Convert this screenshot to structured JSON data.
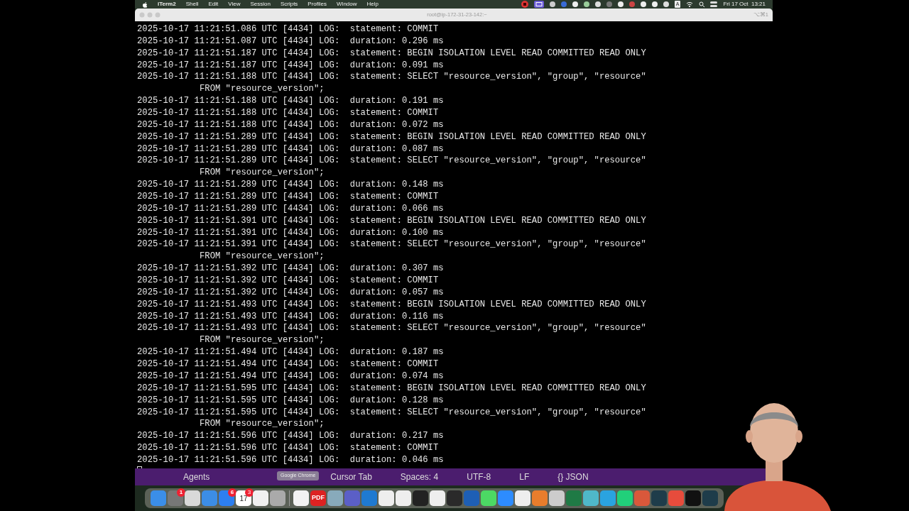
{
  "menu_bar": {
    "app": "iTerm2",
    "menus": [
      "Shell",
      "Edit",
      "View",
      "Session",
      "Scripts",
      "Profiles",
      "Window",
      "Help"
    ],
    "input_source": "A",
    "clock": "Fri 17 Oct  13:21"
  },
  "window": {
    "title": "root@ip-172-31-23-142:~",
    "shortcut": "⌥⌘1"
  },
  "terminal": {
    "lines": [
      {
        "kind": "log",
        "text": "2025-10-17 11:21:51.086 UTC [4434] LOG:  statement: COMMIT"
      },
      {
        "kind": "log",
        "text": "2025-10-17 11:21:51.087 UTC [4434] LOG:  duration: 0.296 ms"
      },
      {
        "kind": "log",
        "text": "2025-10-17 11:21:51.187 UTC [4434] LOG:  statement: BEGIN ISOLATION LEVEL READ COMMITTED READ ONLY"
      },
      {
        "kind": "log",
        "text": "2025-10-17 11:21:51.187 UTC [4434] LOG:  duration: 0.091 ms"
      },
      {
        "kind": "log",
        "text": "2025-10-17 11:21:51.188 UTC [4434] LOG:  statement: SELECT \"resource_version\", \"group\", \"resource\""
      },
      {
        "kind": "continuation",
        "text": "FROM \"resource_version\";"
      },
      {
        "kind": "log",
        "text": "2025-10-17 11:21:51.188 UTC [4434] LOG:  duration: 0.191 ms"
      },
      {
        "kind": "log",
        "text": "2025-10-17 11:21:51.188 UTC [4434] LOG:  statement: COMMIT"
      },
      {
        "kind": "log",
        "text": "2025-10-17 11:21:51.188 UTC [4434] LOG:  duration: 0.072 ms"
      },
      {
        "kind": "log",
        "text": "2025-10-17 11:21:51.289 UTC [4434] LOG:  statement: BEGIN ISOLATION LEVEL READ COMMITTED READ ONLY"
      },
      {
        "kind": "log",
        "text": "2025-10-17 11:21:51.289 UTC [4434] LOG:  duration: 0.087 ms"
      },
      {
        "kind": "log",
        "text": "2025-10-17 11:21:51.289 UTC [4434] LOG:  statement: SELECT \"resource_version\", \"group\", \"resource\""
      },
      {
        "kind": "continuation",
        "text": "FROM \"resource_version\";"
      },
      {
        "kind": "log",
        "text": "2025-10-17 11:21:51.289 UTC [4434] LOG:  duration: 0.148 ms"
      },
      {
        "kind": "log",
        "text": "2025-10-17 11:21:51.289 UTC [4434] LOG:  statement: COMMIT"
      },
      {
        "kind": "log",
        "text": "2025-10-17 11:21:51.289 UTC [4434] LOG:  duration: 0.066 ms"
      },
      {
        "kind": "log",
        "text": "2025-10-17 11:21:51.391 UTC [4434] LOG:  statement: BEGIN ISOLATION LEVEL READ COMMITTED READ ONLY"
      },
      {
        "kind": "log",
        "text": "2025-10-17 11:21:51.391 UTC [4434] LOG:  duration: 0.100 ms"
      },
      {
        "kind": "log",
        "text": "2025-10-17 11:21:51.391 UTC [4434] LOG:  statement: SELECT \"resource_version\", \"group\", \"resource\""
      },
      {
        "kind": "continuation",
        "text": "FROM \"resource_version\";"
      },
      {
        "kind": "log",
        "text": "2025-10-17 11:21:51.392 UTC [4434] LOG:  duration: 0.307 ms"
      },
      {
        "kind": "log",
        "text": "2025-10-17 11:21:51.392 UTC [4434] LOG:  statement: COMMIT"
      },
      {
        "kind": "log",
        "text": "2025-10-17 11:21:51.392 UTC [4434] LOG:  duration: 0.057 ms"
      },
      {
        "kind": "log",
        "text": "2025-10-17 11:21:51.493 UTC [4434] LOG:  statement: BEGIN ISOLATION LEVEL READ COMMITTED READ ONLY"
      },
      {
        "kind": "log",
        "text": "2025-10-17 11:21:51.493 UTC [4434] LOG:  duration: 0.116 ms"
      },
      {
        "kind": "log",
        "text": "2025-10-17 11:21:51.493 UTC [4434] LOG:  statement: SELECT \"resource_version\", \"group\", \"resource\""
      },
      {
        "kind": "continuation",
        "text": "FROM \"resource_version\";"
      },
      {
        "kind": "log",
        "text": "2025-10-17 11:21:51.494 UTC [4434] LOG:  duration: 0.187 ms"
      },
      {
        "kind": "log",
        "text": "2025-10-17 11:21:51.494 UTC [4434] LOG:  statement: COMMIT"
      },
      {
        "kind": "log",
        "text": "2025-10-17 11:21:51.494 UTC [4434] LOG:  duration: 0.074 ms"
      },
      {
        "kind": "log",
        "text": "2025-10-17 11:21:51.595 UTC [4434] LOG:  statement: BEGIN ISOLATION LEVEL READ COMMITTED READ ONLY"
      },
      {
        "kind": "log",
        "text": "2025-10-17 11:21:51.595 UTC [4434] LOG:  duration: 0.128 ms"
      },
      {
        "kind": "log",
        "text": "2025-10-17 11:21:51.595 UTC [4434] LOG:  statement: SELECT \"resource_version\", \"group\", \"resource\""
      },
      {
        "kind": "continuation",
        "text": "FROM \"resource_version\";"
      },
      {
        "kind": "log",
        "text": "2025-10-17 11:21:51.596 UTC [4434] LOG:  duration: 0.217 ms"
      },
      {
        "kind": "log",
        "text": "2025-10-17 11:21:51.596 UTC [4434] LOG:  statement: COMMIT"
      },
      {
        "kind": "log",
        "text": "2025-10-17 11:21:51.596 UTC [4434] LOG:  duration: 0.046 ms"
      },
      {
        "kind": "cursor"
      }
    ]
  },
  "editor_status_bar": {
    "items": [
      "Agents",
      "Cursor Tab",
      "Spaces: 4",
      "UTF-8",
      "LF",
      "{} JSON"
    ]
  },
  "tooltip": "Google Chrome",
  "dock": {
    "items": [
      {
        "kind": "app"
      },
      {
        "kind": "app",
        "badge": "1"
      },
      {
        "kind": "app"
      },
      {
        "kind": "app"
      },
      {
        "kind": "app",
        "badge": "6"
      },
      {
        "kind": "calendar",
        "text": "17",
        "badge": "3"
      },
      {
        "kind": "app"
      },
      {
        "kind": "app"
      },
      {
        "kind": "separator"
      },
      {
        "kind": "app"
      },
      {
        "kind": "pdf",
        "text": "PDF"
      },
      {
        "kind": "app"
      },
      {
        "kind": "app"
      },
      {
        "kind": "app"
      },
      {
        "kind": "app"
      },
      {
        "kind": "app"
      },
      {
        "kind": "app"
      },
      {
        "kind": "app"
      },
      {
        "kind": "app"
      },
      {
        "kind": "app"
      },
      {
        "kind": "app"
      },
      {
        "kind": "app"
      },
      {
        "kind": "app"
      },
      {
        "kind": "app"
      },
      {
        "kind": "app"
      },
      {
        "kind": "app"
      },
      {
        "kind": "app"
      },
      {
        "kind": "app"
      },
      {
        "kind": "app"
      },
      {
        "kind": "app"
      },
      {
        "kind": "app"
      },
      {
        "kind": "app"
      },
      {
        "kind": "app"
      },
      {
        "kind": "app"
      }
    ]
  }
}
